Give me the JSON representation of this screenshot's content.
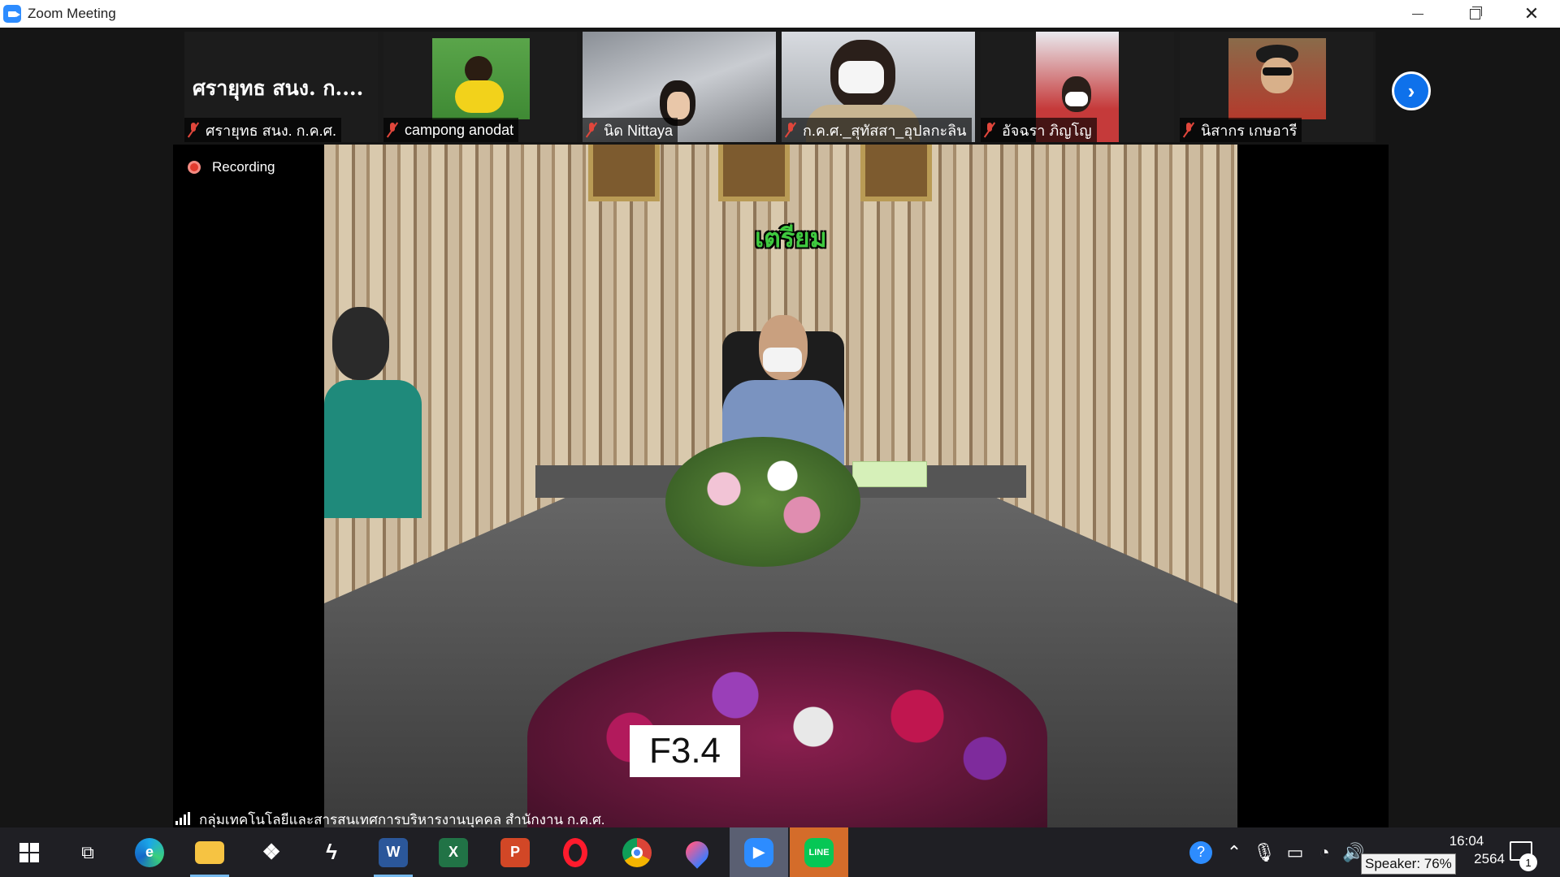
{
  "window": {
    "title": "Zoom Meeting"
  },
  "strip": {
    "participants": [
      {
        "tile_name": "ศรายุทธ สนง. ก....",
        "label": "ศรายุทธ สนง. ก.ค.ศ.",
        "muted": true
      },
      {
        "label": "campong anodat",
        "muted": true
      },
      {
        "label": "นิด Nittaya",
        "muted": true
      },
      {
        "label": "ก.ค.ศ._สุทัสสา_อุปลกะลิน",
        "muted": true
      },
      {
        "label": "อัจฉรา ภิญโญ",
        "muted": true
      },
      {
        "label": "นิสากร เกษอารี",
        "muted": true
      }
    ],
    "next_icon": "chevron-right-icon"
  },
  "stage": {
    "recording_label": "Recording",
    "overlay_text": "เตรียม",
    "tag_text": "F3.4",
    "caption": "กลุ่มเทคโนโลยีและสารสนเทศการบริหารงานบุคคล สำนักงาน ก.ค.ศ."
  },
  "taskbar": {
    "apps": [
      "windows-start",
      "task-view",
      "edge",
      "file-explorer",
      "dropbox",
      "app-bolt",
      "word",
      "excel",
      "powerpoint",
      "opera",
      "chrome",
      "app-drop",
      "zoom",
      "line"
    ],
    "clock_time": "16:04",
    "clock_date_partial": "2564",
    "tooltip": "Speaker: 76%",
    "notification_count": "1"
  },
  "colors": {
    "zoom_blue": "#2d8cff",
    "mic_off": "#e0463b",
    "recording": "#e23b2e",
    "taskbar": "#1f1f24"
  }
}
